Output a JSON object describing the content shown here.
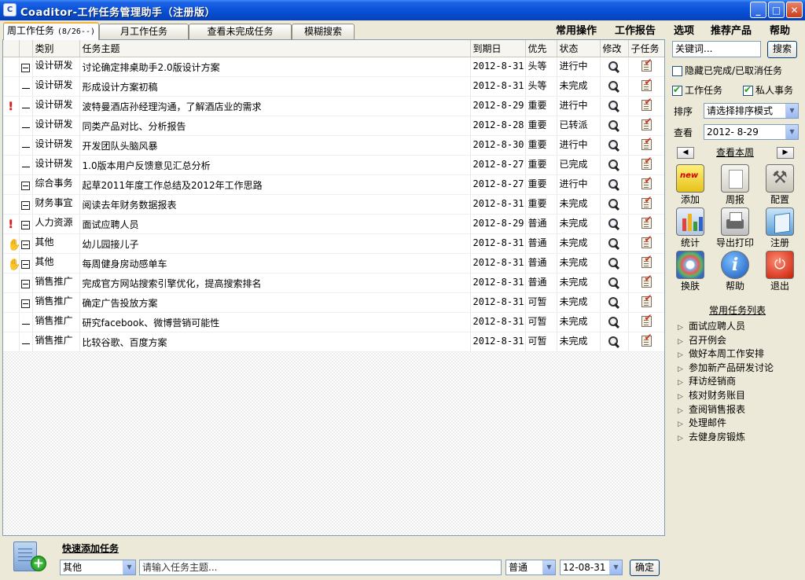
{
  "window": {
    "title": "Coaditor-工作任务管理助手（注册版）",
    "icon_text": "C",
    "buttons": {
      "minimize": "_",
      "maximize": "□",
      "close": "✕"
    }
  },
  "tabs": [
    {
      "label": "周工作任务",
      "count": "(8/26--)"
    },
    {
      "label": "月工作任务"
    },
    {
      "label": "查看未完成任务"
    },
    {
      "label": "模糊搜索"
    }
  ],
  "menu": [
    "常用操作",
    "工作报告",
    "选项",
    "推荐产品",
    "帮助"
  ],
  "grid": {
    "columns": [
      "类别",
      "任务主题",
      "到期日",
      "优先",
      "状态",
      "修改",
      "子任务"
    ],
    "rows": [
      {
        "flag": "",
        "expander": "box",
        "category": "设计研发",
        "subject": "讨论确定排桌助手2.0版设计方案",
        "due": "2012-8-31",
        "priority": "头等",
        "status": "进行中"
      },
      {
        "flag": "",
        "expander": "dash",
        "category": "设计研发",
        "subject": "形成设计方案初稿",
        "due": "2012-8-31",
        "priority": "头等",
        "status": "未完成"
      },
      {
        "flag": "!",
        "expander": "dash",
        "category": "设计研发",
        "subject": "波特曼酒店孙经理沟通，了解酒店业的需求",
        "due": "2012-8-29",
        "priority": "重要",
        "status": "进行中"
      },
      {
        "flag": "",
        "expander": "dash",
        "category": "设计研发",
        "subject": "同类产品对比、分析报告",
        "due": "2012-8-28",
        "priority": "重要",
        "status": "已转派"
      },
      {
        "flag": "",
        "expander": "dash",
        "category": "设计研发",
        "subject": "开发团队头脑风暴",
        "due": "2012-8-30",
        "priority": "重要",
        "status": "进行中"
      },
      {
        "flag": "",
        "expander": "dash",
        "category": "设计研发",
        "subject": "1.0版本用户反馈意见汇总分析",
        "due": "2012-8-27",
        "priority": "重要",
        "status": "已完成"
      },
      {
        "flag": "",
        "expander": "box",
        "category": "综合事务",
        "subject": "起草2011年度工作总结及2012年工作思路",
        "due": "2012-8-27",
        "priority": "重要",
        "status": "进行中"
      },
      {
        "flag": "",
        "expander": "box",
        "category": "财务事宜",
        "subject": "阅读去年财务数据报表",
        "due": "2012-8-31",
        "priority": "重要",
        "status": "未完成"
      },
      {
        "flag": "!",
        "expander": "box",
        "category": "人力资源",
        "subject": "面试应聘人员",
        "due": "2012-8-29",
        "priority": "普通",
        "status": "未完成"
      },
      {
        "flag": "hand",
        "expander": "box",
        "category": "其他",
        "subject": "幼儿园接儿子",
        "due": "2012-8-31",
        "priority": "普通",
        "status": "未完成"
      },
      {
        "flag": "hand",
        "expander": "box",
        "category": "其他",
        "subject": "每周健身房动感单车",
        "due": "2012-8-31",
        "priority": "普通",
        "status": "未完成"
      },
      {
        "flag": "",
        "expander": "box",
        "category": "销售推广",
        "subject": "完成官方网站搜索引擎优化，提高搜索排名",
        "due": "2012-8-31",
        "priority": "普通",
        "status": "未完成"
      },
      {
        "flag": "",
        "expander": "box",
        "category": "销售推广",
        "subject": "确定广告投放方案",
        "due": "2012-8-31",
        "priority": "可暂",
        "status": "未完成"
      },
      {
        "flag": "",
        "expander": "dash",
        "category": "销售推广",
        "subject": "研究facebook、微博营销可能性",
        "due": "2012-8-31",
        "priority": "可暂",
        "status": "未完成"
      },
      {
        "flag": "",
        "expander": "dash",
        "category": "销售推广",
        "subject": "比较谷歌、百度方案",
        "due": "2012-8-31",
        "priority": "可暂",
        "status": "未完成"
      }
    ]
  },
  "quick_add": {
    "title": "快速添加任务",
    "category": "其他",
    "subject_placeholder": "请输入任务主题...",
    "priority": "普通",
    "date": "12-08-31",
    "confirm": "确定"
  },
  "side": {
    "search_placeholder": "关键词...",
    "search_button": "搜索",
    "hide_done": "隐藏已完成/已取消任务",
    "work_tasks": "工作任务",
    "private_tasks": "私人事务",
    "sort_label": "排序",
    "sort_value": "请选择排序模式",
    "view_label": "查看",
    "view_value": "2012- 8-29",
    "prev": "◀",
    "next": "▶",
    "view_week": "查看本周",
    "tools": [
      "添加",
      "周报",
      "配置",
      "统计",
      "导出打印",
      "注册",
      "换肤",
      "帮助",
      "退出"
    ],
    "tool_icons": [
      "new-icon",
      "weekly-report-icon",
      "tools-icon",
      "stats-icon",
      "printer-icon",
      "register-icon",
      "skin-icon",
      "help-icon",
      "exit-icon"
    ],
    "new_badge": "new",
    "help_glyph": "i",
    "exit_glyph": "⏻",
    "config_glyph": "⚒",
    "common_title": "常用任务列表",
    "common_tasks": [
      "面试应聘人员",
      "召开例会",
      "做好本周工作安排",
      "参加新产品研发讨论",
      "拜访经销商",
      "核对财务账目",
      "查阅销售报表",
      "处理邮件",
      "去健身房锻炼"
    ]
  },
  "colors": {
    "titlebar": "#0A53D9",
    "panel": "#ECE9D8",
    "flag_red": "#E21A1A",
    "tab_accent": "#F4B33D"
  }
}
